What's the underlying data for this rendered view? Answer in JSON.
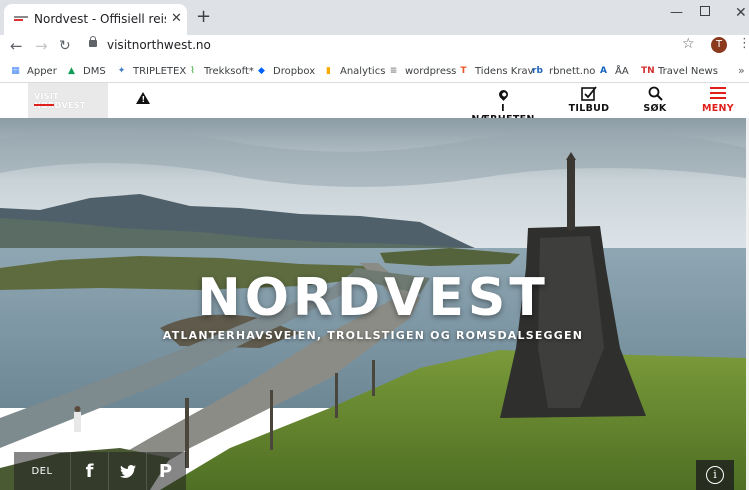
{
  "browser": {
    "tab_title": "Nordvest - Offisiell reiseguide for",
    "tab_close": "✕",
    "new_tab": "+",
    "window_minimize": "—",
    "window_close": "✕",
    "url": "visitnorthwest.no",
    "profile_initial": "T",
    "bookmarks": [
      {
        "label": "Apper",
        "icon": "apps-grid-icon",
        "color": "#4285f4"
      },
      {
        "label": "DMS",
        "icon": "drive-icon",
        "color": "#0f9d58"
      },
      {
        "label": "TRIPLETEX",
        "icon": "tripletex-icon",
        "color": "#3b7cc4"
      },
      {
        "label": "Trekksoft*",
        "icon": "trekksoft-icon",
        "color": "#4caf50"
      },
      {
        "label": "Dropbox",
        "icon": "dropbox-icon",
        "color": "#0061ff"
      },
      {
        "label": "Analytics",
        "icon": "analytics-icon",
        "color": "#f9ab00"
      },
      {
        "label": "wordpress",
        "icon": "wordpress-icon",
        "color": "#8a8a8a"
      },
      {
        "label": "Tidens Krav",
        "icon": "tidens-krav-icon",
        "color": "#e8562a"
      },
      {
        "label": "rbnett.no",
        "icon": "rbnett-icon",
        "color": "#1e63b5"
      },
      {
        "label": "ÅA",
        "icon": "aa-icon",
        "color": "#1565c0"
      },
      {
        "label": "Travel News",
        "icon": "travel-news-icon",
        "color": "#d32f2f"
      }
    ],
    "bookmarks_more": "»"
  },
  "site": {
    "logo_text": "VISIT NORDVEST",
    "nav": {
      "near": "I NÆRHETEN",
      "offers": "TILBUD",
      "search": "SØK",
      "menu": "MENY"
    },
    "accent_color": "#e0201b"
  },
  "hero": {
    "title": "NORDVEST",
    "subtitle": "ATLANTERHAVSVEIEN, TROLLSTIGEN OG ROMSDALSEGGEN",
    "share_label": "DEL",
    "share_facebook": "f",
    "share_pinterest": "P",
    "info_icon": "i"
  }
}
